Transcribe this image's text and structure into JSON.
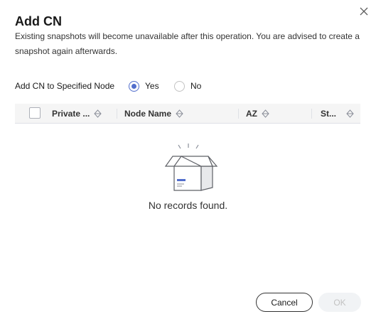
{
  "dialog": {
    "title": "Add CN",
    "description": "Existing snapshots will become unavailable after this operation. You are advised to create a snapshot again afterwards.",
    "close_icon": "close-icon"
  },
  "field": {
    "label": "Add CN to Specified Node",
    "options": [
      {
        "label": "Yes",
        "selected": true
      },
      {
        "label": "No",
        "selected": false
      }
    ]
  },
  "table": {
    "columns": [
      {
        "label": "Private ..."
      },
      {
        "label": "Node Name"
      },
      {
        "label": "AZ"
      },
      {
        "label": "St..."
      }
    ],
    "empty_text": "No records found."
  },
  "footer": {
    "cancel_label": "Cancel",
    "ok_label": "OK"
  },
  "colors": {
    "accent": "#526ecc",
    "disabled_bg": "#f1f3f5",
    "disabled_text": "#c2c2c2"
  }
}
